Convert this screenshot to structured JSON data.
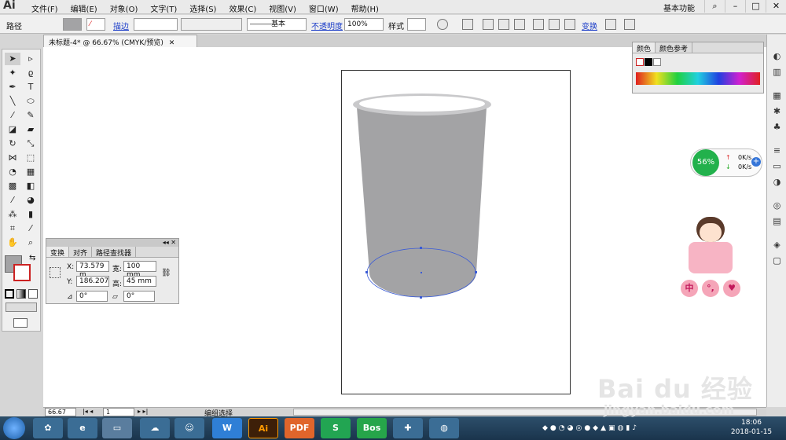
{
  "app": {
    "logo": "Ai",
    "workspace": "基本功能"
  },
  "menu": [
    "文件(F)",
    "编辑(E)",
    "对象(O)",
    "文字(T)",
    "选择(S)",
    "效果(C)",
    "视图(V)",
    "窗口(W)",
    "帮助(H)"
  ],
  "control_bar": {
    "selection_type": "路径",
    "stroke_label": "描边",
    "brush_label": "基本",
    "opacity_label": "不透明度",
    "opacity_value": "100%",
    "style_label": "样式",
    "transform_label": "变换"
  },
  "document": {
    "tab_title": "未标题-4* @ 66.67% (CMYK/预览)"
  },
  "transform_panel": {
    "tabs": [
      "变换",
      "对齐",
      "路径查找器"
    ],
    "x_label": "X:",
    "x_value": "73.579 m",
    "y_label": "Y:",
    "y_value": "186.207",
    "w_label": "宽:",
    "w_value": "100 mm",
    "h_label": "高:",
    "h_value": "45 mm",
    "rotate_value": "0°",
    "shear_value": "0°"
  },
  "color_panel": {
    "tabs": [
      "颜色",
      "颜色参考"
    ]
  },
  "status": {
    "zoom": "66.67",
    "page": "1",
    "tool_status": "编组选择"
  },
  "net_widget": {
    "percent": "56%",
    "up": "0K/s",
    "down": "0K/s"
  },
  "sticker": {
    "chars": [
      "中",
      "°,",
      "♥"
    ]
  },
  "taskbar": {
    "apps": [
      "W",
      "Ai",
      "PDF",
      "S",
      "Bos"
    ],
    "time": "18:06",
    "date": "2018-01-15"
  },
  "watermark": {
    "brand": "Bai du 经验",
    "url": "jingyan.baidu.com"
  },
  "colors": {
    "cup_body": "#a3a3a5",
    "cup_rim": "#c9c9cb",
    "selection": "#3a5bd6",
    "widget_green": "#22b14c"
  }
}
